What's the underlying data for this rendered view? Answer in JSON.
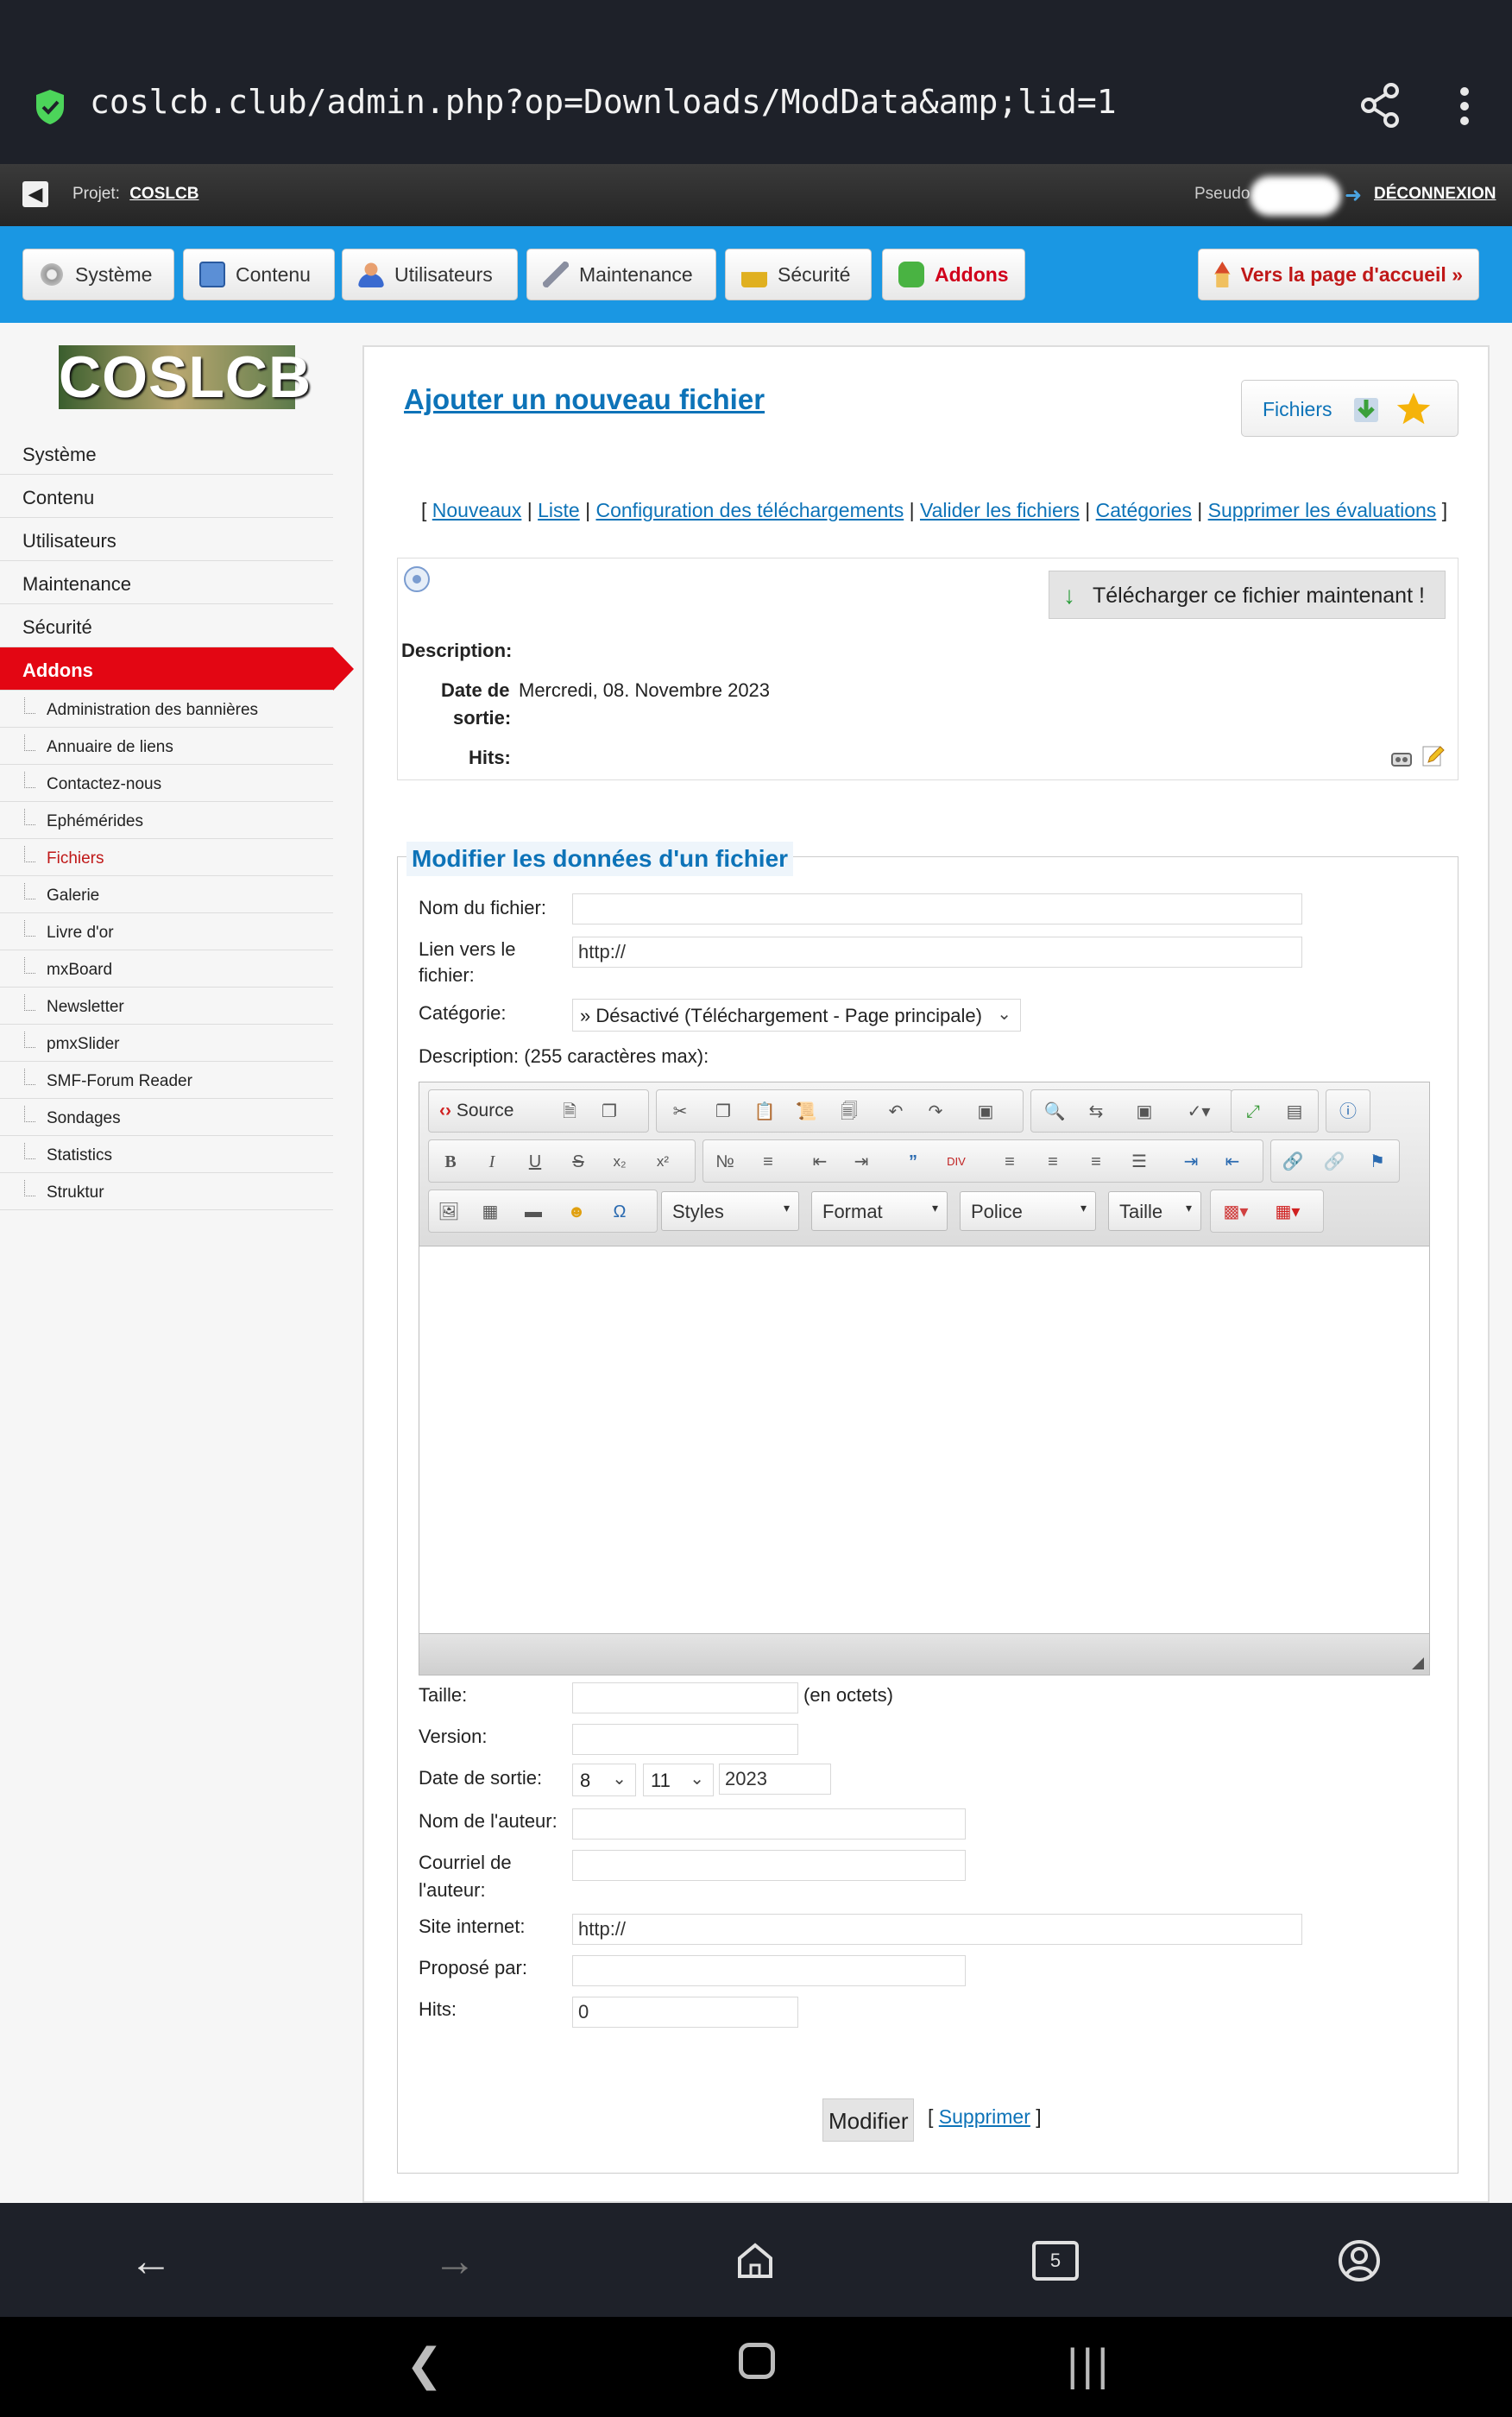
{
  "browser": {
    "url": "coslcb.club/admin.php?op=Downloads/ModData&amp;lid=1",
    "icons": [
      "shield-check-icon",
      "share-icon",
      "kebab-menu-icon"
    ]
  },
  "project_bar": {
    "label": "Projet:",
    "project_name": "COSLCB",
    "pseudo_label": "Pseudo",
    "logout": "DÉCONNEXION"
  },
  "topnav": {
    "items": [
      {
        "label": "Système",
        "icon": "gear-icon"
      },
      {
        "label": "Contenu",
        "icon": "document-icon"
      },
      {
        "label": "Utilisateurs",
        "icon": "user-icon"
      },
      {
        "label": "Maintenance",
        "icon": "wrench-icon"
      },
      {
        "label": "Sécurité",
        "icon": "lock-icon"
      },
      {
        "label": "Addons",
        "icon": "puzzle-icon",
        "active": true
      }
    ],
    "home_button": "Vers la page d'accueil »",
    "accent_color": "#1a97e3"
  },
  "sidebar": {
    "logo_text": "COSLCB",
    "items": [
      "Système",
      "Contenu",
      "Utilisateurs",
      "Maintenance",
      "Sécurité",
      "Addons"
    ],
    "active_item": "Addons",
    "sub_items": [
      "Administration des bannières",
      "Annuaire de liens",
      "Contactez-nous",
      "Ephémérides",
      "Fichiers",
      "Galerie",
      "Livre d'or",
      "mxBoard",
      "Newsletter",
      "pmxSlider",
      "SMF-Forum Reader",
      "Sondages",
      "Statistics",
      "Struktur"
    ],
    "current_sub_item": "Fichiers",
    "active_color": "#e30613"
  },
  "main": {
    "title": "Ajouter un nouveau fichier",
    "fichiers_button": "Fichiers",
    "links": {
      "open": "[",
      "close": "]",
      "separator": "|",
      "items": [
        "Nouveaux",
        "Liste",
        "Configuration des téléchargements",
        "Valider les fichiers",
        "Catégories",
        "Supprimer les évaluations"
      ]
    },
    "file_box": {
      "download_button": "Télécharger ce fichier maintenant !",
      "description_label": "Description:",
      "date_label_1": "Date de",
      "date_label_2": "sortie:",
      "date_value": "Mercredi, 08. Novembre 2023",
      "hits_label": "Hits:"
    },
    "form": {
      "legend": "Modifier les données d'un fichier",
      "name_label": "Nom du fichier:",
      "name_value": "",
      "link_label_1": "Lien vers le",
      "link_label_2": "fichier:",
      "link_value": "http://",
      "category_label": "Catégorie:",
      "category_value": "» Désactivé (Téléchargement - Page principale)",
      "description_label": "Description: (255 caractères max):",
      "editor": {
        "source_label": "Source",
        "combos": [
          "Styles",
          "Format",
          "Police",
          "Taille"
        ]
      },
      "size_label": "Taille:",
      "size_value": "",
      "size_unit": "(en octets)",
      "version_label": "Version:",
      "version_value": "",
      "date_label": "Date de sortie:",
      "date_day": "8",
      "date_month": "11",
      "date_year": "2023",
      "author_label": "Nom de l'auteur:",
      "author_value": "",
      "email_label_1": "Courriel de",
      "email_label_2": "l'auteur:",
      "email_value": "",
      "website_label": "Site internet:",
      "website_value": "http://",
      "proposed_label": "Proposé par:",
      "proposed_value": "",
      "hits_label": "Hits:",
      "hits_value": "0",
      "submit_label": "Modifier",
      "delete_open": "[",
      "delete_label": "Supprimer",
      "delete_close": "]"
    }
  },
  "bottom_nav": {
    "tab_count": "5",
    "icons": [
      "back-icon",
      "forward-icon",
      "home-icon",
      "tabs-icon",
      "account-icon"
    ]
  }
}
